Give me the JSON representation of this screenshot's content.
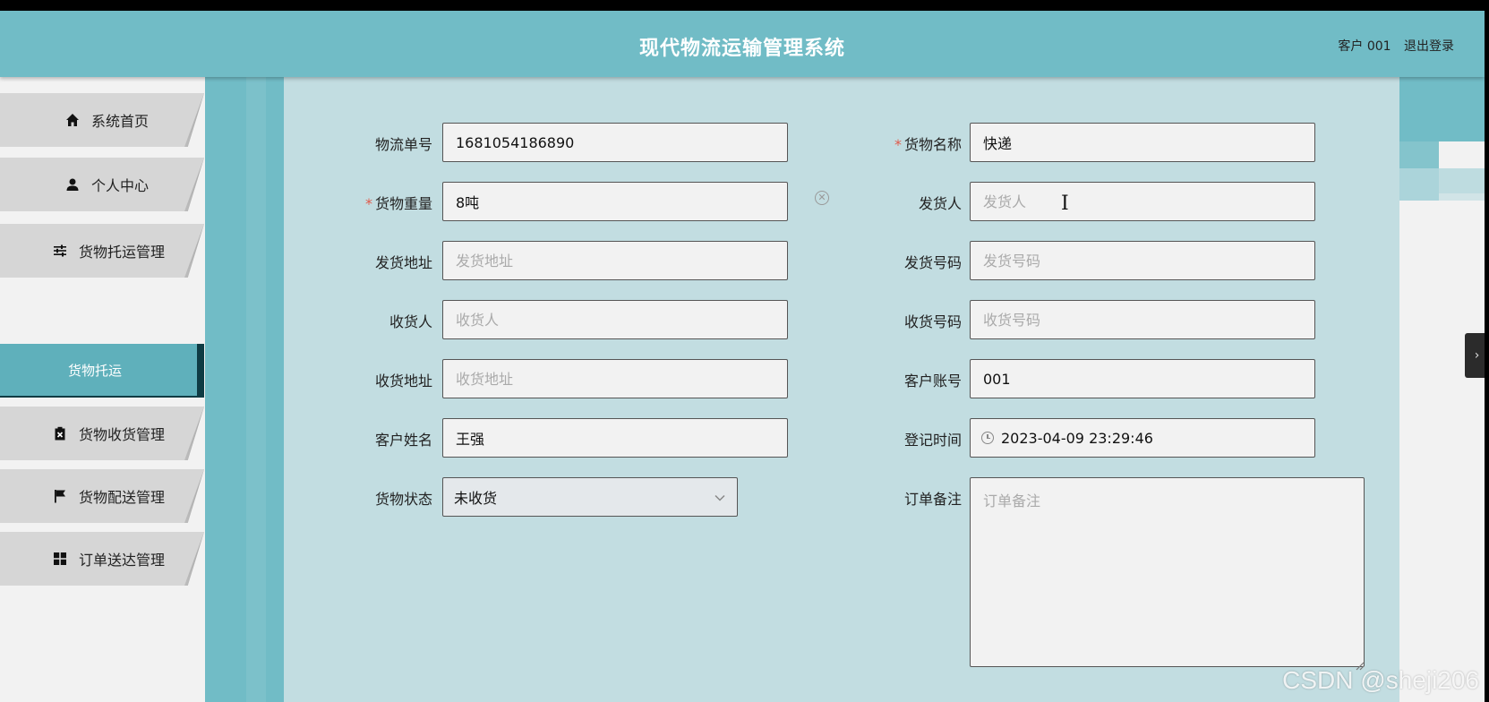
{
  "header": {
    "title": "现代物流运输管理系统",
    "user": "客户 001",
    "logout": "退出登录"
  },
  "sidebar": {
    "items": [
      {
        "label": "系统首页",
        "icon": "home-icon"
      },
      {
        "label": "个人中心",
        "icon": "user-icon"
      },
      {
        "label": "货物托运管理",
        "icon": "sliders-icon"
      },
      {
        "label": "货物收货管理",
        "icon": "clipboard-x-icon"
      },
      {
        "label": "货物配送管理",
        "icon": "flag-icon"
      },
      {
        "label": "订单送达管理",
        "icon": "grid-icon"
      }
    ],
    "active_submenu": "货物托运"
  },
  "form": {
    "tracking_no": {
      "label": "物流单号",
      "value": "1681054186890"
    },
    "goods_name": {
      "label": "货物名称",
      "value": "快递",
      "required": "*"
    },
    "goods_weight": {
      "label": "货物重量",
      "value": "8吨",
      "required": "*"
    },
    "sender": {
      "label": "发货人",
      "placeholder": "发货人"
    },
    "sender_address": {
      "label": "发货地址",
      "placeholder": "发货地址"
    },
    "sender_phone": {
      "label": "发货号码",
      "placeholder": "发货号码"
    },
    "receiver": {
      "label": "收货人",
      "placeholder": "收货人"
    },
    "receiver_phone": {
      "label": "收货号码",
      "placeholder": "收货号码"
    },
    "receiver_address": {
      "label": "收货地址",
      "placeholder": "收货地址"
    },
    "customer_account": {
      "label": "客户账号",
      "value": "001"
    },
    "customer_name": {
      "label": "客户姓名",
      "value": "王强"
    },
    "register_time": {
      "label": "登记时间",
      "value": "2023-04-09 23:29:46"
    },
    "goods_status": {
      "label": "货物状态",
      "value": "未收货"
    },
    "order_note": {
      "label": "订单备注",
      "placeholder": "订单备注"
    }
  },
  "watermark": "CSDN @sheji206",
  "colors": {
    "accent": "#71bcc6",
    "content_bg": "#c2dde1",
    "required": "#e05a4b"
  }
}
